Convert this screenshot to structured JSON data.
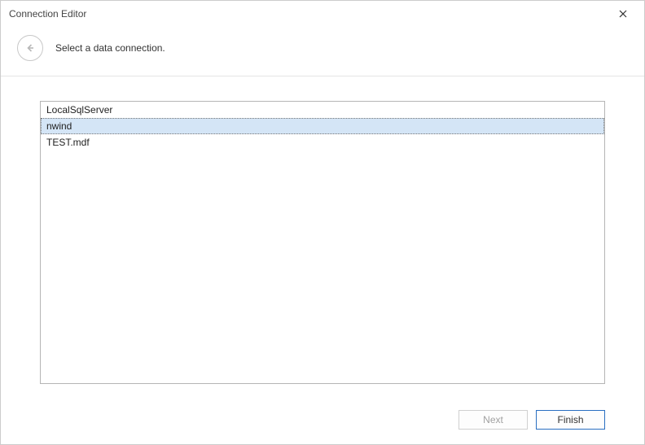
{
  "window": {
    "title": "Connection Editor"
  },
  "header": {
    "prompt": "Select a data connection."
  },
  "connections": {
    "items": [
      {
        "label": "LocalSqlServer",
        "selected": false
      },
      {
        "label": "nwind",
        "selected": true
      },
      {
        "label": "TEST.mdf",
        "selected": false
      }
    ]
  },
  "footer": {
    "next_label": "Next",
    "finish_label": "Finish"
  }
}
